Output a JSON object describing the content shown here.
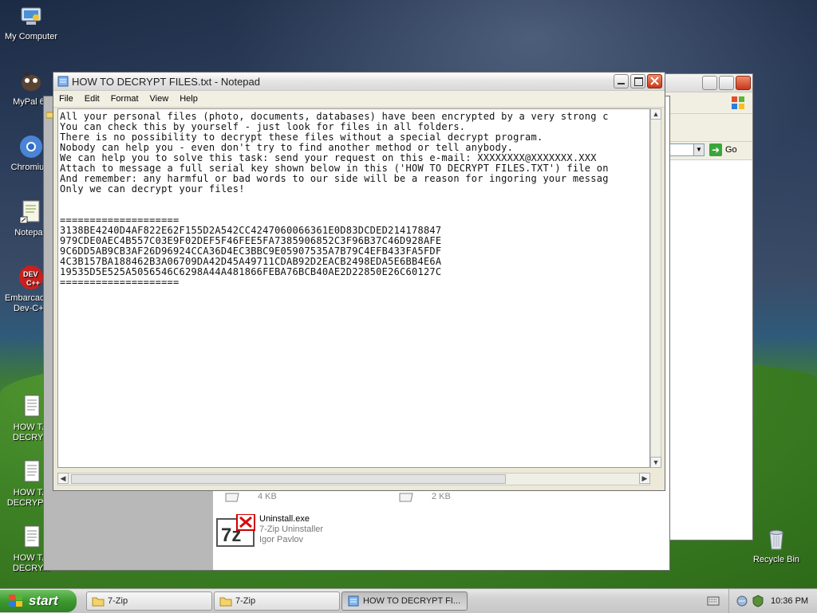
{
  "desktop_icons": [
    {
      "name": "my-computer-icon",
      "label": "My Computer"
    },
    {
      "name": "mypal-icon",
      "label": "MyPal 68"
    },
    {
      "name": "chromium-icon",
      "label": "Chromium"
    },
    {
      "name": "notepadpp-icon",
      "label": "Notepad"
    },
    {
      "name": "embarcadero-icon",
      "label": "Embarcadero Dev-C++"
    },
    {
      "name": "how-to-decrypt-icon-1",
      "label": "HOW T... DECRY..."
    },
    {
      "name": "how-to-decrypt-icon-2",
      "label": "HOW T... DECRYPT..."
    },
    {
      "name": "how-to-decrypt-icon-3",
      "label": "HOW T... DECRY..."
    },
    {
      "name": "recycle-bin-icon",
      "label": "Recycle Bin"
    }
  ],
  "notepad": {
    "title": "HOW TO DECRYPT FILES.txt - Notepad",
    "menu": [
      "File",
      "Edit",
      "Format",
      "View",
      "Help"
    ],
    "content": "All your personal files (photo, documents, databases) have been encrypted by a very strong c\nYou can check this by yourself - just look for files in all folders.\nThere is no possibility to decrypt these files without a special decrypt program.\nNobody can help you - even don't try to find another method or tell anybody.\nWe can help you to solve this task: send your request on this e-mail: XXXXXXXX@XXXXXXX.XXX\nAttach to message a full serial key shown below in this ('HOW TO DECRYPT FILES.TXT') file on\nAnd remember: any harmful or bad words to our side will be a reason for ingoring your messag\nOnly we can decrypt your files!\n\n\n====================\n3138BE4240D4AF822E62F155D2A542CC4247060066361E0D83DCDED214178847\n979CDE0AEC4B557C03E9F02DEF5F46FEE5FA7385906852C3F96B37C46D928AFE\n9C6DD5AB9CB3AF26D96924CCA36D4EC3BBC9E05907535A7B79C4EFB433FA5FDF\n4C3B157BA188462B3A06709DA42D45A49711CDAB92D2EACB2498EDA5E6BB4E6A\n19535D5E525A5056546C6298A44A481866FEBA76BCB40AE2D22850E26C60127C\n===================="
  },
  "explorer": {
    "size_a": "4 KB",
    "size_b": "2 KB",
    "file": {
      "name": "Uninstall.exe",
      "desc": "7-Zip Uninstaller",
      "author": "Igor Pavlov"
    },
    "go_label": "Go"
  },
  "taskbar": {
    "start_label": "start",
    "tasks": [
      {
        "label": "7-Zip",
        "active": false
      },
      {
        "label": "7-Zip",
        "active": false
      },
      {
        "label": "HOW TO DECRYPT FI...",
        "active": true
      }
    ],
    "clock": "10:36 PM"
  }
}
